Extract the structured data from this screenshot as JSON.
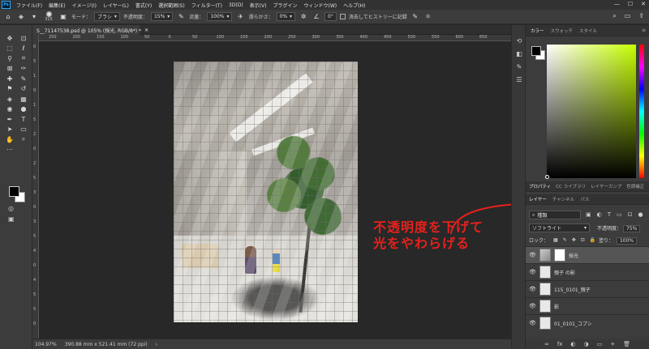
{
  "menubar": {
    "logo": "Ps",
    "items": [
      "ファイル(F)",
      "編集(E)",
      "イメージ(I)",
      "レイヤー(L)",
      "書式(Y)",
      "選択範囲(S)",
      "フィルター(T)",
      "3D(D)",
      "表示(V)",
      "プラグイン",
      "ウィンドウ(W)",
      "ヘルプ(H)"
    ],
    "window_controls": [
      "—",
      "☐",
      "✕"
    ]
  },
  "options": {
    "brush_size": "315",
    "mode_label": "モード：",
    "mode_value": "ブラシ",
    "opacity_label": "不透明度：",
    "opacity_value": "15%",
    "flow_label": "流量：",
    "flow_value": "100%",
    "smoothing_label": "滑らかさ：",
    "smoothing_value": "0%",
    "angle_value": "0°",
    "history_label": "消去してヒストリーに記録"
  },
  "document": {
    "tab_title": "S__71147538.psd @ 105% (採光, RGB/8*) *",
    "close": "✕"
  },
  "ruler": {
    "top_labels": [
      "250",
      "200",
      "150",
      "100",
      "50",
      "0",
      "50",
      "100",
      "150",
      "200",
      "250",
      "300",
      "350",
      "400",
      "450",
      "500",
      "550",
      "600",
      "650"
    ],
    "left_labels": [
      "0",
      "5",
      "1",
      "0",
      "1",
      "5",
      "2",
      "0",
      "2",
      "5",
      "3",
      "0",
      "3",
      "5",
      "4",
      "0",
      "4",
      "5",
      "5",
      "0"
    ]
  },
  "annotation": {
    "line1": "不透明度を下げて",
    "line2": "光をやわらげる",
    "color": "#e6211c"
  },
  "status": {
    "zoom": "104.97%",
    "doc_size": "390.88 mm x 521.41 mm (72 ppi)",
    "arrow": "›"
  },
  "color_panel": {
    "tabs": [
      "カラー",
      "スウォッチ",
      "スタイル"
    ],
    "foreground": "#000000",
    "background": "#ffffff",
    "hue": "#c6ff00"
  },
  "properties_tabs": [
    "プロパティ",
    "CC ライブラリ",
    "レイヤーカンプ",
    "色調補正"
  ],
  "layers_panel": {
    "tabs": [
      "レイヤー",
      "チャンネル",
      "パス"
    ],
    "filter_value": "種類",
    "blend_mode": "ソフトライト",
    "opacity_label": "不透明度：",
    "opacity_value": "75%",
    "lock_label": "ロック：",
    "fill_label": "塗り：",
    "fill_value": "100%",
    "layers": [
      {
        "name": "採光",
        "active": true,
        "mask": true
      },
      {
        "name": "親子 の影",
        "active": false,
        "mask": false
      },
      {
        "name": "115_0101_親子",
        "active": false,
        "mask": false
      },
      {
        "name": "影",
        "active": false,
        "mask": false
      },
      {
        "name": "01_0101_コブシ",
        "active": false,
        "mask": false
      }
    ],
    "footer_icons": [
      "∞",
      "fx",
      "◐",
      "◑",
      "▭",
      "+",
      "🗑"
    ]
  }
}
